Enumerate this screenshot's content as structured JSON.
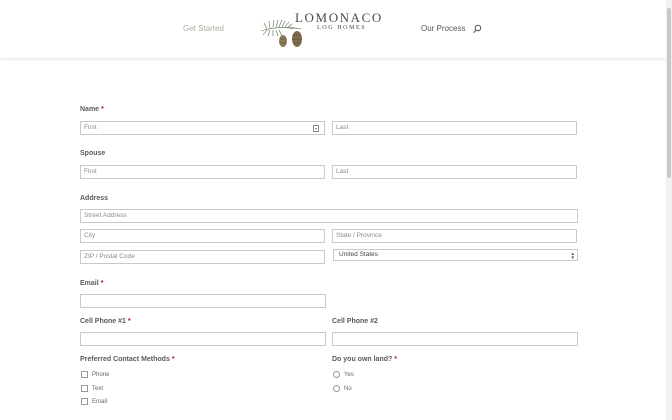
{
  "nav": {
    "left_link": "Get Started",
    "right_link": "Our Process"
  },
  "logo": {
    "title": "LOMONACO",
    "subtitle": "LOG HOMES"
  },
  "form": {
    "name": {
      "label": "Name",
      "required_mark": "*",
      "first_placeholder": "First",
      "last_placeholder": "Last"
    },
    "spouse": {
      "label": "Spouse",
      "first_placeholder": "First",
      "last_placeholder": "Last"
    },
    "address": {
      "label": "Address",
      "street_placeholder": "Street Address",
      "city_placeholder": "City",
      "state_placeholder": "State / Province",
      "zip_placeholder": "ZIP / Postal Code",
      "country_value": "United States"
    },
    "email": {
      "label": "Email",
      "required_mark": "*"
    },
    "cell1": {
      "label": "Cell Phone #1",
      "required_mark": "*"
    },
    "cell2": {
      "label": "Cell Phone #2"
    },
    "contact_methods": {
      "label": "Preferred Contact Methods",
      "required_mark": "*",
      "options": [
        "Phone",
        "Text",
        "Email"
      ]
    },
    "own_land": {
      "label": "Do you own land?",
      "required_mark": "*",
      "options": [
        "Yes",
        "No"
      ]
    }
  },
  "colors": {
    "required": "#9b1b1b",
    "nav_muted": "#a9b2a0"
  }
}
